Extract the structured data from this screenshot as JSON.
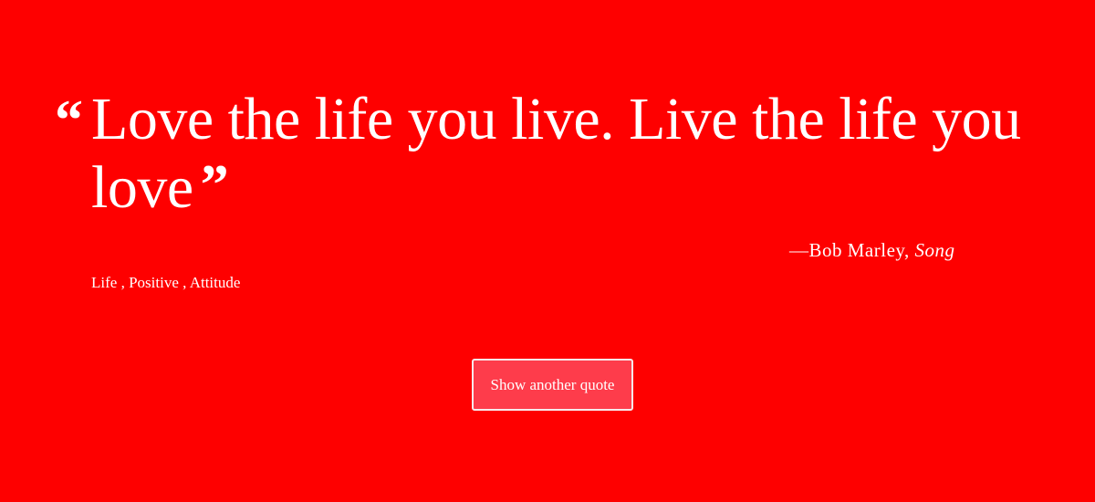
{
  "quote": {
    "open_mark": "“",
    "text": "Love the life you live. Live the life you love",
    "close_mark": "”"
  },
  "attribution": {
    "dash": "—",
    "author": "Bob Marley",
    "separator": ", ",
    "source": "Song"
  },
  "tags": [
    {
      "label": "Life"
    },
    {
      "label": "Positive"
    },
    {
      "label": "Attitude"
    }
  ],
  "tag_separator": " , ",
  "button": {
    "label": "Show another quote"
  },
  "colors": {
    "background": "#fe0000",
    "text": "#ffffff",
    "button_background": "#fe3c4b",
    "button_border": "#f7e9eb"
  }
}
